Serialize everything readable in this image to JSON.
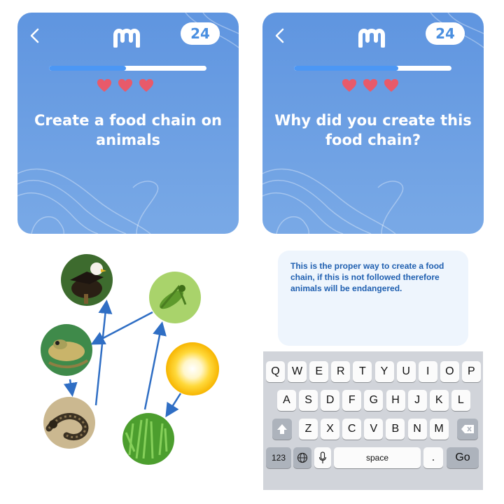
{
  "screen_left": {
    "level_badge": "24",
    "progress_fraction": 0.49,
    "hearts": 3,
    "question": "Create a food chain on animals"
  },
  "screen_right": {
    "level_badge": "24",
    "progress_fraction": 0.66,
    "hearts": 3,
    "question": "Why did you create this food chain?",
    "answer_text": "This is the proper way to create a food chain, if this is not followed therefore animals will be endangered."
  },
  "colors": {
    "card_blue": "#5f95e0",
    "progress_blue": "#4c97f4",
    "heart_red": "#e85a6a",
    "answer_text": "#1f5fb0",
    "arrow_blue": "#2f6ec4"
  },
  "food_chain": {
    "nodes": [
      "eagle",
      "grasshopper",
      "frog",
      "sun",
      "snake",
      "grass"
    ],
    "arrows": [
      [
        "grass",
        "grasshopper"
      ],
      [
        "grasshopper",
        "frog"
      ],
      [
        "frog",
        "snake"
      ],
      [
        "snake",
        "eagle"
      ],
      [
        "sun",
        "grass"
      ]
    ]
  },
  "keyboard": {
    "row1": [
      "Q",
      "W",
      "E",
      "R",
      "T",
      "Y",
      "U",
      "I",
      "O",
      "P"
    ],
    "row2": [
      "A",
      "S",
      "D",
      "F",
      "G",
      "H",
      "J",
      "K",
      "L"
    ],
    "row3": [
      "Z",
      "X",
      "C",
      "V",
      "B",
      "N",
      "M"
    ],
    "numbers_key": "123",
    "space_key": "space",
    "period_key": ".",
    "go_key": "Go"
  }
}
